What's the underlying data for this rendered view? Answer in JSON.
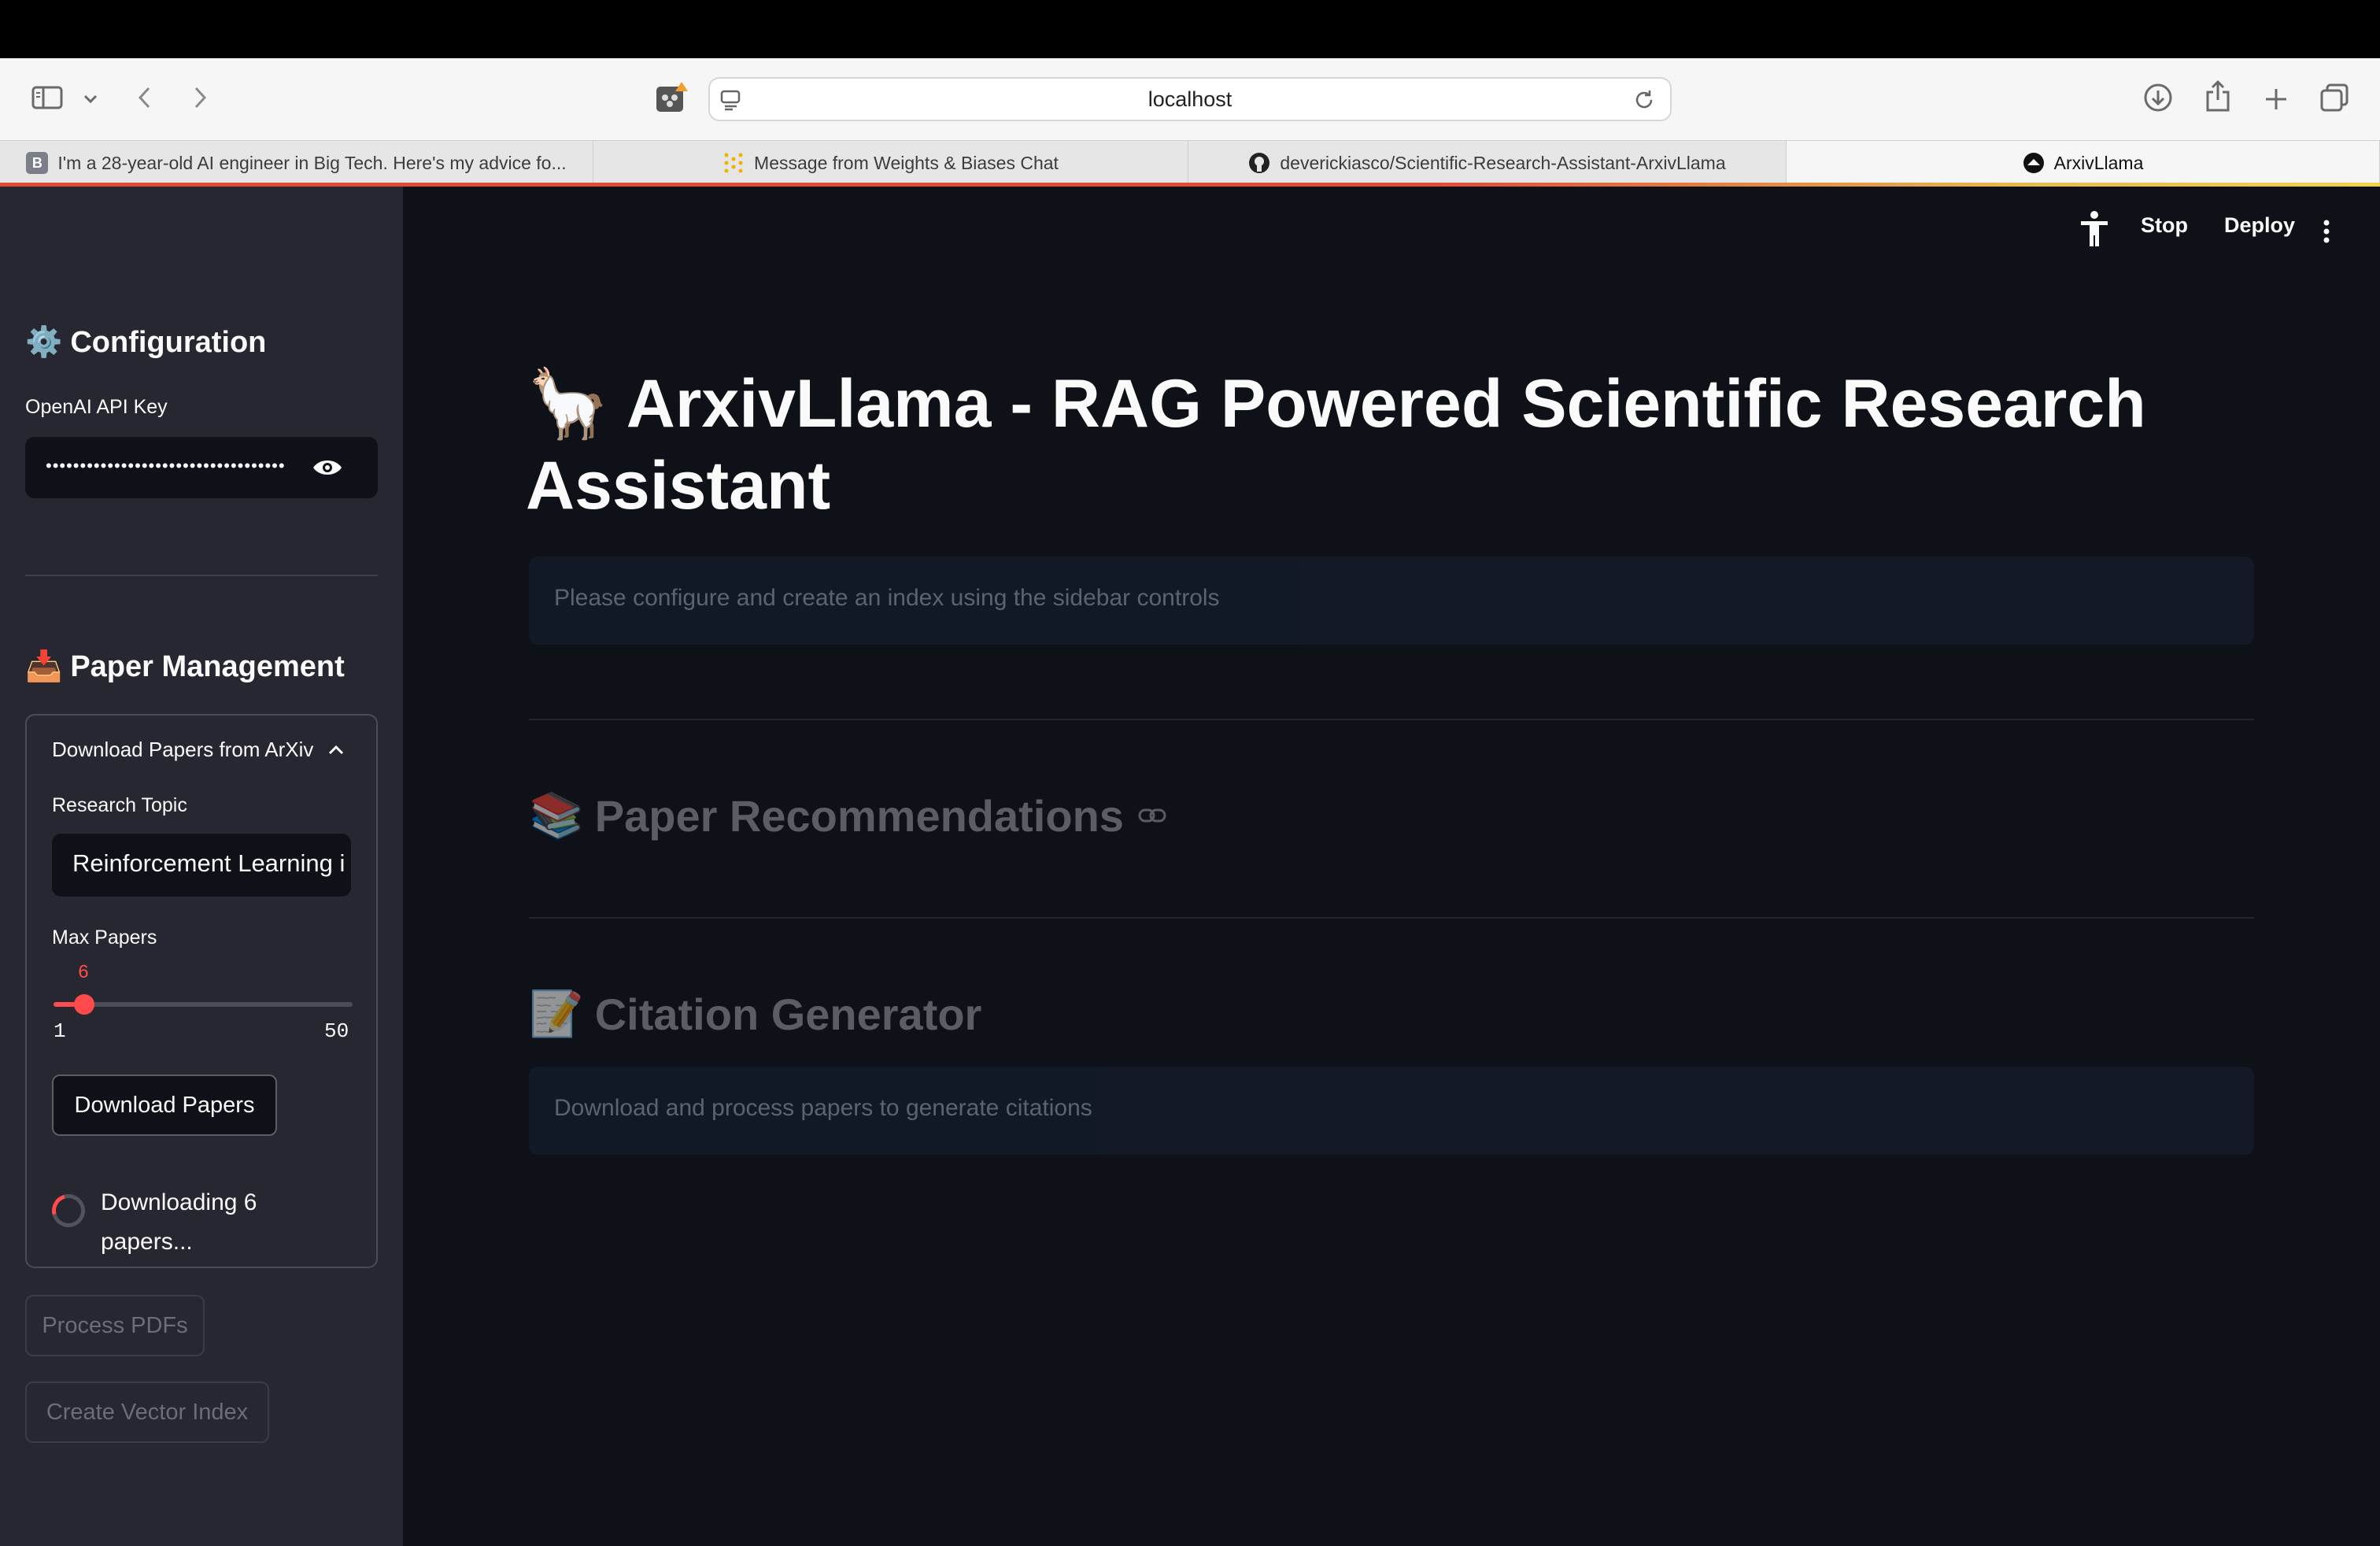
{
  "browser": {
    "address": "localhost",
    "tabs": [
      {
        "label": "I'm a 28-year-old AI engineer in Big Tech. Here's my advice fo...",
        "favicon": "B"
      },
      {
        "label": "Message from Weights & Biases Chat"
      },
      {
        "label": "deverickiasco/Scientific-Research-Assistant-ArxivLlama"
      },
      {
        "label": "ArxivLlama"
      }
    ]
  },
  "sidebar": {
    "config_heading": "Configuration",
    "config_icon": "⚙️",
    "api_key_label": "OpenAI API Key",
    "api_key_value": "•••••••••••••••••••••••••••••••••••",
    "paper_heading": "Paper Management",
    "paper_icon": "📥",
    "expander_title": "Download Papers from ArXiv",
    "topic_label": "Research Topic",
    "topic_value": "Reinforcement Learning i",
    "max_label": "Max Papers",
    "max_value": "6",
    "max_min": "1",
    "max_max": "50",
    "download_button": "Download Papers",
    "spinner_text": "Downloading 6 papers...",
    "process_button": "Process PDFs",
    "vector_button": "Create Vector Index"
  },
  "header": {
    "stop": "Stop",
    "deploy": "Deploy"
  },
  "main": {
    "title_icon": "🦙",
    "title": "ArxivLlama - RAG Powered Scientific Research Assistant",
    "info": "Please configure and create an index using the sidebar controls",
    "rec_icon": "📚",
    "rec_heading": "Paper Recommendations",
    "cite_icon": "📝",
    "cite_heading": "Citation Generator",
    "cite_info": "Download and process papers to generate citations"
  },
  "colors": {
    "accent": "#ff4b4b",
    "background": "#0e1117",
    "sidebar": "#262730"
  }
}
